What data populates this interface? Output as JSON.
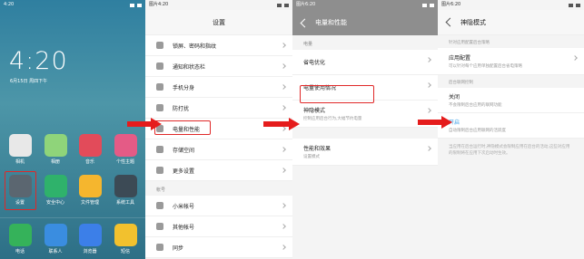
{
  "home": {
    "status_time": "4:20",
    "clock": "4:20",
    "date": "6月15日 周四下午",
    "apps_row1": [
      {
        "label": "相机",
        "icon": "camera-icon",
        "color": "#e8e8e8"
      },
      {
        "label": "相册",
        "icon": "gallery-icon",
        "color": "#8fd47a"
      },
      {
        "label": "音乐",
        "icon": "music-icon",
        "color": "#e24b5a"
      },
      {
        "label": "个性主题",
        "icon": "theme-icon",
        "color": "#e45b86"
      }
    ],
    "apps_row2": [
      {
        "label": "设置",
        "icon": "gear-icon",
        "color": "#5b6670"
      },
      {
        "label": "安全中心",
        "icon": "shield-icon",
        "color": "#2fb26b"
      },
      {
        "label": "文件管理",
        "icon": "folder-icon",
        "color": "#f5b62e"
      },
      {
        "label": "系统工具",
        "icon": "tools-icon",
        "color": "#3c4a55"
      }
    ],
    "dock": [
      {
        "label": "电话",
        "icon": "phone-icon",
        "color": "#35b25a"
      },
      {
        "label": "联系人",
        "icon": "contacts-icon",
        "color": "#3a8de0"
      },
      {
        "label": "浏览器",
        "icon": "browser-icon",
        "color": "#3c7fe8"
      },
      {
        "label": "短信",
        "icon": "message-icon",
        "color": "#f2c12e"
      }
    ]
  },
  "settings": {
    "status_time": "图片4:20",
    "title": "设置",
    "items_top": [
      {
        "label": "锁屏、密码和指纹"
      },
      {
        "label": "通知和状态栏"
      },
      {
        "label": "手机分身"
      },
      {
        "label": "防打扰"
      },
      {
        "label": "电量和性能"
      },
      {
        "label": "存储空间"
      },
      {
        "label": "更多设置"
      }
    ],
    "section_account": "帐号",
    "items_account": [
      {
        "label": "小米帐号"
      },
      {
        "label": "其他帐号"
      },
      {
        "label": "同步"
      }
    ]
  },
  "battery": {
    "status_time": "图片6:20",
    "title": "电量和性能",
    "section": "电量",
    "items": [
      {
        "label": "省电优化",
        "sub": ""
      },
      {
        "label": "电量使用情况",
        "sub": ""
      },
      {
        "label": "神隐模式",
        "sub": "控制应用后台行为,大幅节约电量"
      },
      {
        "label": "性能和效果",
        "sub": "设置模式"
      }
    ]
  },
  "hidden": {
    "status_time": "图片6:20",
    "title": "神隐模式",
    "hint": "针对应用配置后台策略",
    "app_config_label": "应用配置",
    "app_config_sub": "可以针对每个应用单独配置后台省电策略",
    "section_bg": "后台联网控制",
    "off_label": "关闭",
    "off_sub": "不会限制后台应用的联网功能",
    "on_label": "开启",
    "on_sub": "自动限制后台应用联网的活跃度",
    "footnote": "当应用在后台运行时,神隐模式会限制应用在后台的活动,这些对应用的限制将在应用下次启动时生效。"
  }
}
